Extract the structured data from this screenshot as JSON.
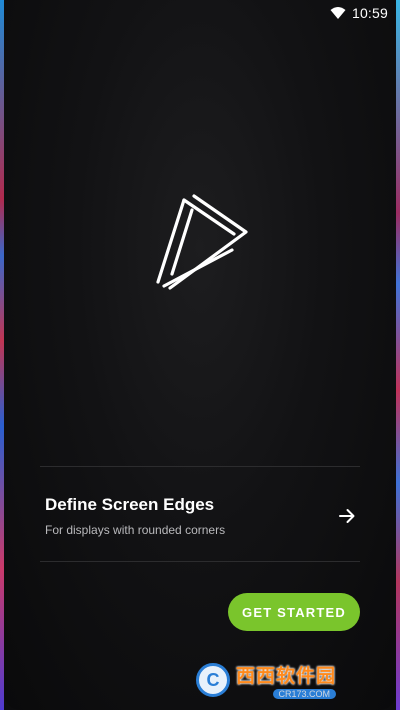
{
  "status_bar": {
    "time": "10:59",
    "wifi_icon": "wifi-icon"
  },
  "logo": {
    "icon": "triangle-play-logo-icon"
  },
  "edges_option": {
    "title": "Define Screen Edges",
    "subtitle": "For displays with rounded corners",
    "arrow_icon": "arrow-right-icon"
  },
  "cta": {
    "label": "GET STARTED",
    "color": "#7ac52c"
  },
  "watermark": {
    "cn_text": "西西软件园",
    "url": "CR173.COM"
  },
  "colors": {
    "background": "#0c0c0e",
    "divider": "#2c2c2e",
    "edge_red": "#c13553",
    "edge_blue": "#3b67c9"
  }
}
